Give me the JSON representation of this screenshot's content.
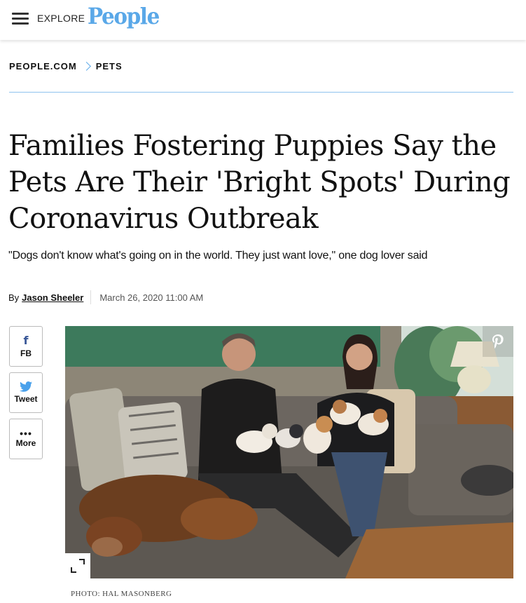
{
  "nav": {
    "explore_label": "EXPLORE",
    "logo_text": "People",
    "logo_color": "#5aa8e8"
  },
  "breadcrumb": {
    "items": [
      "PEOPLE.COM",
      "PETS"
    ],
    "separator_color": "#5aa8e8"
  },
  "article": {
    "headline": "Families Fostering Puppies Say the Pets Are Their 'Bright Spots' During Coronavirus Outbreak",
    "dek": "\"Dogs don't know what's going on in the world. They just want love,\" one dog lover said",
    "byline_prefix": "By",
    "author": "Jason Sheeler",
    "date": "March 26, 2020 11:00 AM"
  },
  "share": {
    "buttons": [
      {
        "icon": "facebook-icon",
        "label": "FB",
        "color": "#3b5998"
      },
      {
        "icon": "twitter-icon",
        "label": "Tweet",
        "color": "#4aa1eb"
      },
      {
        "icon": "more-dots-icon",
        "label": "More"
      }
    ]
  },
  "photo": {
    "icons": [
      "pinterest-icon",
      "expand-icon"
    ],
    "credit": "PHOTO: HAL MASONBERG"
  }
}
